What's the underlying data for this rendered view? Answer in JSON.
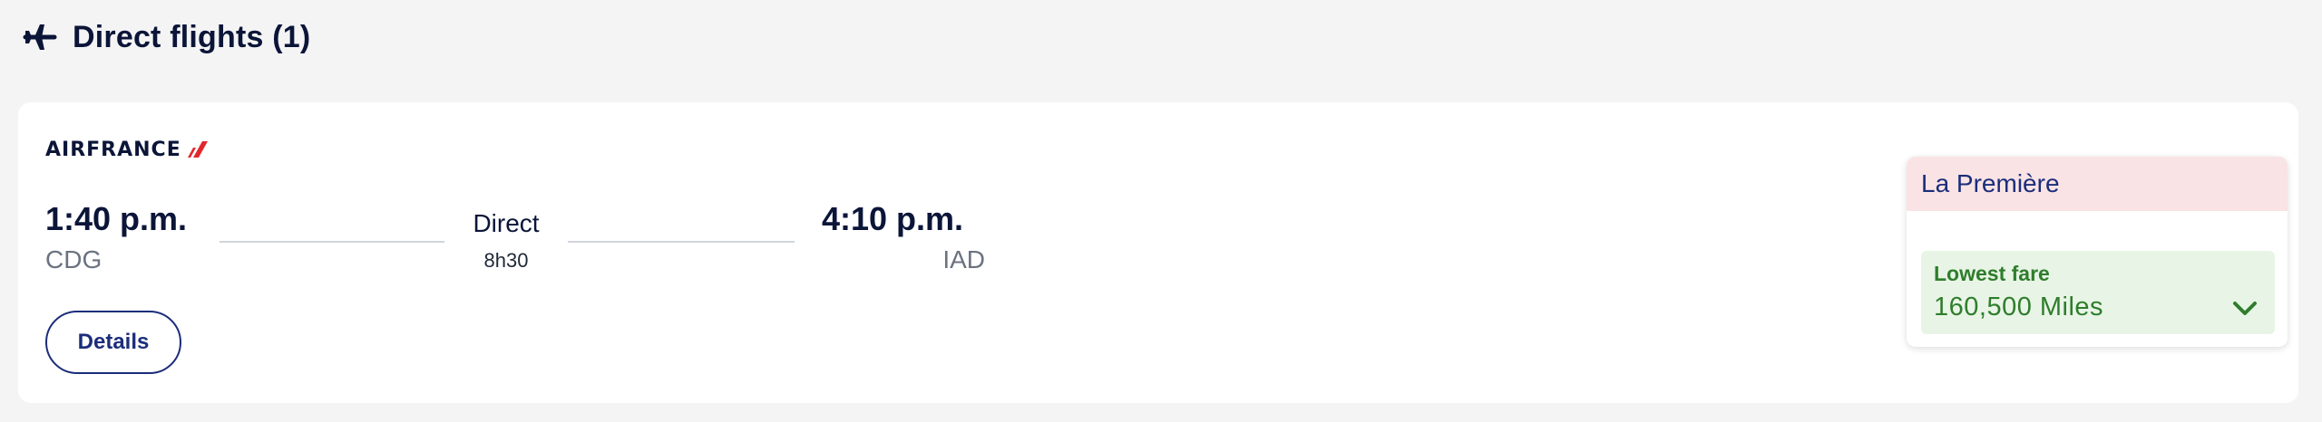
{
  "section": {
    "title": "Direct flights (1)",
    "icon": "airplane-icon"
  },
  "flight": {
    "airline": {
      "name": "AIRFRANCE",
      "logo_color": "#e4262c"
    },
    "departure": {
      "time": "1:40 p.m.",
      "airport": "CDG"
    },
    "arrival": {
      "time": "4:10 p.m.",
      "airport": "IAD"
    },
    "stops": "Direct",
    "duration": "8h30",
    "details_label": "Details"
  },
  "cabin": {
    "name": "La Première",
    "fare_label": "Lowest fare",
    "price": "160,500 Miles",
    "icon": "chevron-down-icon",
    "colors": {
      "header_bg": "#f9e3e5",
      "fare_bg": "#e8f5e6",
      "fare_text": "#2f7d2c"
    }
  }
}
